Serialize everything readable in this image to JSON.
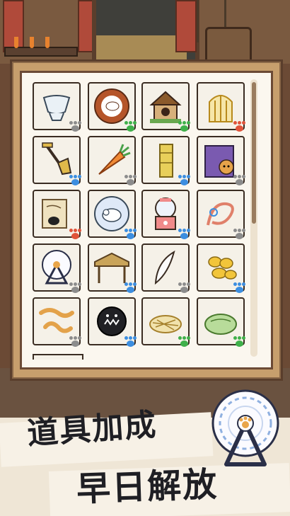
{
  "promo": {
    "line1": "道具加成",
    "line2": "早日解放"
  },
  "inventory": {
    "items": [
      {
        "name": "glass-bowl",
        "paw_color": "#8c8c8c"
      },
      {
        "name": "fish-plate",
        "paw_color": "#3fb04a"
      },
      {
        "name": "wooden-cat-house",
        "paw_color": "#3fb04a"
      },
      {
        "name": "birdcage",
        "paw_color": "#e0533a"
      },
      {
        "name": "shovel",
        "paw_color": "#3c8ee0"
      },
      {
        "name": "carrot",
        "paw_color": "#8c8c8c"
      },
      {
        "name": "scratching-post",
        "paw_color": "#3c8ee0"
      },
      {
        "name": "paper-bag-cat",
        "paw_color": "#8c8c8c"
      },
      {
        "name": "paper-scroll",
        "paw_color": "#e0533a"
      },
      {
        "name": "sheep-plate",
        "paw_color": "#3c8ee0"
      },
      {
        "name": "gacha-machine",
        "paw_color": "#3c8ee0"
      },
      {
        "name": "rope-toy",
        "paw_color": "#8c8c8c"
      },
      {
        "name": "hamster-wheel",
        "paw_color": "#8c8c8c"
      },
      {
        "name": "straw-hut",
        "paw_color": "#3c8ee0"
      },
      {
        "name": "feather",
        "paw_color": "#8c8c8c"
      },
      {
        "name": "corn-pile",
        "paw_color": "#3c8ee0"
      },
      {
        "name": "worms",
        "paw_color": "#8c8c8c"
      },
      {
        "name": "black-spiky-ball",
        "paw_color": "#3c8ee0"
      },
      {
        "name": "hay-nest",
        "paw_color": "#3fb04a"
      },
      {
        "name": "green-cushion",
        "paw_color": "#3fb04a"
      }
    ]
  },
  "colors": {
    "panel": "#c79f6d",
    "panel_inner": "#fbf7ef",
    "text": "#1f1f24"
  }
}
